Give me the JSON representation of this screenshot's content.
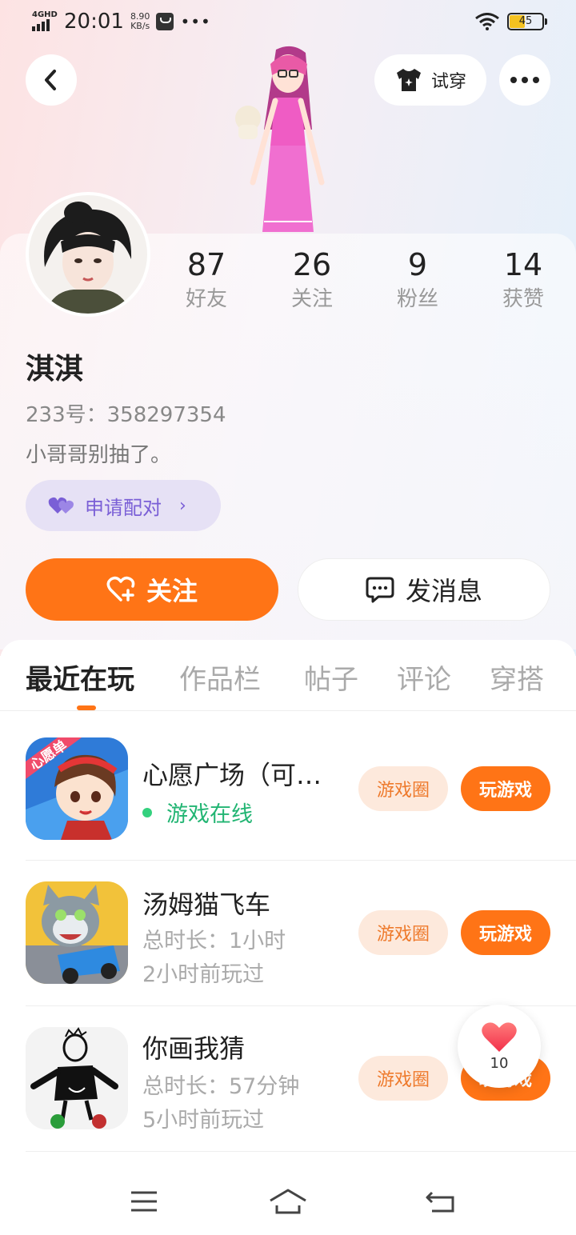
{
  "status_bar": {
    "network": "4GHD",
    "time": "20:01",
    "speed_value": "8.90",
    "speed_unit": "KB/s",
    "battery": "45",
    "battery_level": 0.45,
    "icons": [
      "signal-icon",
      "message-icon",
      "more-dots-icon",
      "wifi-icon",
      "battery-icon"
    ]
  },
  "header": {
    "back_icon": "chevron-left-icon",
    "tryon_label": "试穿",
    "tryon_icon": "tshirt-icon",
    "more_icon": "more-dots-icon"
  },
  "profile": {
    "stats": [
      {
        "value": "87",
        "label": "好友"
      },
      {
        "value": "26",
        "label": "关注"
      },
      {
        "value": "9",
        "label": "粉丝"
      },
      {
        "value": "14",
        "label": "获赞"
      }
    ],
    "name": "淇淇",
    "uid": "233号：358297354",
    "bio": "小哥哥别抽了。",
    "pair_label": "申请配对",
    "follow_label": "关注",
    "message_label": "发消息"
  },
  "tabs": [
    {
      "label": "最近在玩",
      "active": true
    },
    {
      "label": "作品栏",
      "active": false
    },
    {
      "label": "帖子",
      "active": false
    },
    {
      "label": "评论",
      "active": false
    },
    {
      "label": "穿搭",
      "active": false
    }
  ],
  "games": [
    {
      "name": "心愿广场（可…",
      "status": "游戏在线",
      "icon_badge": "心愿单",
      "circle_label": "游戏圈",
      "play_label": "玩游戏"
    },
    {
      "name": "汤姆猫飞车",
      "duration": "总时长：1小时",
      "last_played": "2小时前玩过",
      "circle_label": "游戏圈",
      "play_label": "玩游戏"
    },
    {
      "name": "你画我猜",
      "duration": "总时长：57分钟",
      "last_played": "5小时前玩过",
      "circle_label": "游戏圈",
      "play_label": "玩游戏"
    }
  ],
  "like_float": {
    "count": "10",
    "icon": "heart-icon"
  },
  "colors": {
    "accent": "#ff7416",
    "online": "#22b573",
    "pair": "#7a5fd6"
  },
  "nav": [
    "menu-icon",
    "home-icon",
    "back-icon"
  ]
}
